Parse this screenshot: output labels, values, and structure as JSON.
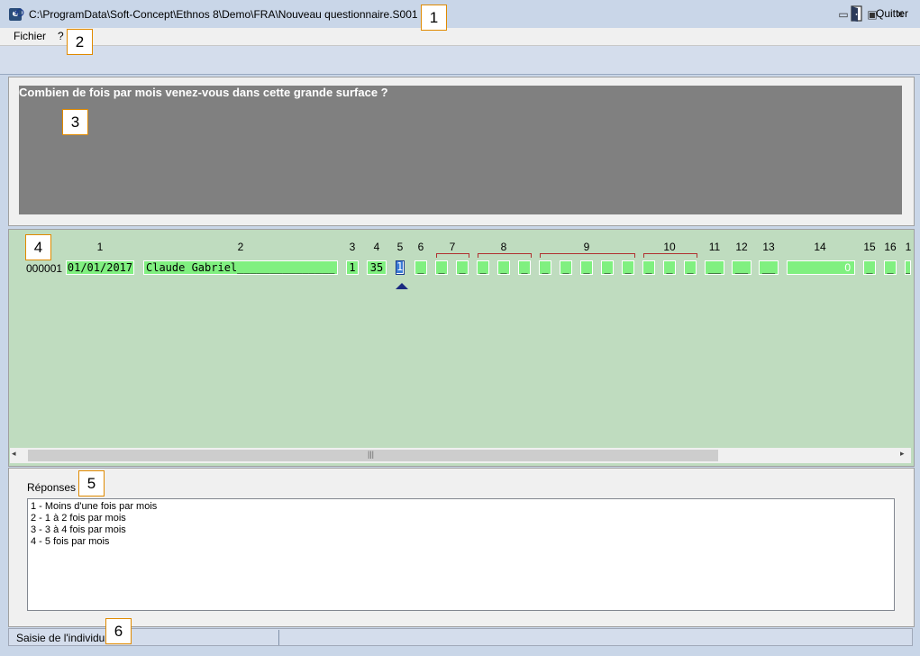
{
  "window": {
    "title": "C:\\ProgramData\\Soft-Concept\\Ethnos 8\\Demo\\FRA\\Nouveau questionnaire.S001",
    "app_icon": "e",
    "minimize_glyph": "▭",
    "maximize_glyph": "▣",
    "close_glyph": "✕"
  },
  "menu": {
    "file": "Fichier",
    "help": "?"
  },
  "toolbar": {
    "undo_glyph": "⟲",
    "quit_label": "Quitter"
  },
  "question": {
    "text": "Combien de fois par mois venez-vous dans cette grande surface ?"
  },
  "grid": {
    "headers": [
      "1",
      "2",
      "3",
      "4",
      "5",
      "6",
      "7",
      "8",
      "9",
      "10",
      "11",
      "12",
      "13",
      "14",
      "15",
      "16",
      "1"
    ],
    "row_id": "000001",
    "cells": {
      "date": "01/01/2017",
      "name": "Claude Gabriel_______________",
      "q3": "1",
      "q4": "35",
      "q5": "1",
      "q14": "0",
      "blank": "_",
      "blank2": "__"
    },
    "scroll_grip": "|||",
    "scroll_left": "◂",
    "scroll_right": "▸"
  },
  "answers": {
    "label": "Réponses :",
    "items": [
      "1 - Moins d'une fois par mois",
      "2 - 1 à 2 fois par mois",
      "3 - 3 à 4 fois par mois",
      "4 - 5 fois par mois"
    ]
  },
  "status": {
    "text": "Saisie de l'individu 1"
  },
  "markers": [
    "1",
    "2",
    "3",
    "4",
    "5",
    "6"
  ],
  "colors": {
    "question_bg": "#808080",
    "grid_bg": "#bfdcbf",
    "cell_green": "#80f080",
    "marker_border": "#e08a00"
  }
}
